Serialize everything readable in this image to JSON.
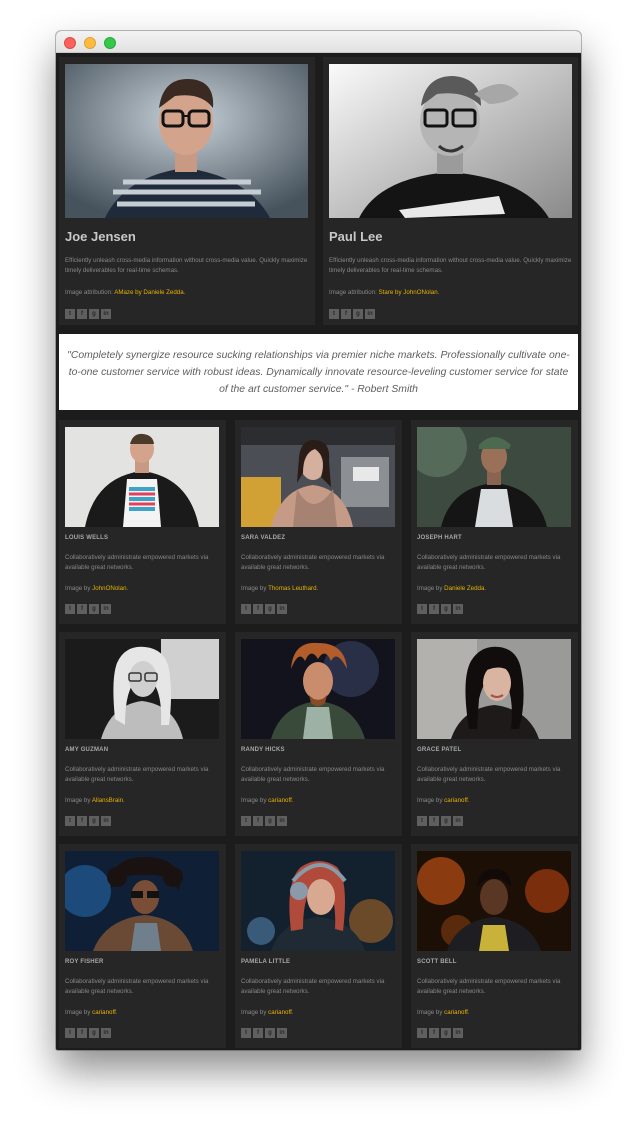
{
  "window": {
    "controls": [
      "close",
      "minimize",
      "zoom"
    ]
  },
  "featured": [
    {
      "name": "Joe Jensen",
      "description": "Efficiently unleash cross-media information without cross-media value. Quickly maximize timely deliverables for real-time schemas.",
      "attribution_prefix": "Image attribution: ",
      "attribution_link": "AMaze by Daniele Zedda",
      "attribution_suffix": "."
    },
    {
      "name": "Paul Lee",
      "description": "Efficiently unleash cross-media information without cross-media value. Quickly maximize timely deliverables for real-time schemas.",
      "attribution_prefix": "Image attribution: ",
      "attribution_link": "Stare by JohnONolan",
      "attribution_suffix": "."
    }
  ],
  "quote": {
    "text": "\"Completely synergize resource sucking relationships via premier niche markets. Professionally cultivate one-to-one customer service with robust ideas. Dynamically innovate resource-leveling customer service for state of the art customer service.\" - Robert Smith"
  },
  "members": [
    {
      "name": "Louis Wells",
      "description": "Collaboratively administrate empowered markets via available great networks.",
      "prefix": "Image by ",
      "link": "JohnONolan",
      "suffix": "."
    },
    {
      "name": "Sara Valdez",
      "description": "Collaboratively administrate empowered markets via available great networks.",
      "prefix": "Image by ",
      "link": "Thomas Leuthard",
      "suffix": "."
    },
    {
      "name": "Joseph Hart",
      "description": "Collaboratively administrate empowered markets via available great networks.",
      "prefix": "Image by ",
      "link": "Daniele Zedda",
      "suffix": "."
    },
    {
      "name": "Amy Guzman",
      "description": "Collaboratively administrate empowered markets via available great networks.",
      "prefix": "Image by ",
      "link": "AllansBrain",
      "suffix": "."
    },
    {
      "name": "Randy Hicks",
      "description": "Collaboratively administrate empowered markets via available great networks.",
      "prefix": "Image by ",
      "link": "carianoff",
      "suffix": "."
    },
    {
      "name": "Grace Patel",
      "description": "Collaboratively administrate empowered markets via available great networks.",
      "prefix": "Image by ",
      "link": "carianoff",
      "suffix": "."
    },
    {
      "name": "Roy Fisher",
      "description": "Collaboratively administrate empowered markets via available great networks.",
      "prefix": "Image by ",
      "link": "carianoff",
      "suffix": "."
    },
    {
      "name": "Pamela Little",
      "description": "Collaboratively administrate empowered markets via available great networks.",
      "prefix": "Image by ",
      "link": "carianoff",
      "suffix": "."
    },
    {
      "name": "Scott Bell",
      "description": "Collaboratively administrate empowered markets via available great networks.",
      "prefix": "Image by ",
      "link": "carianoff",
      "suffix": "."
    }
  ],
  "social_icons": [
    {
      "icon": "twitter-icon",
      "glyph": "t"
    },
    {
      "icon": "facebook-icon",
      "glyph": "f"
    },
    {
      "icon": "google-plus-icon",
      "glyph": "g"
    },
    {
      "icon": "linkedin-icon",
      "glyph": "in"
    }
  ],
  "colors": {
    "accent": "#e7b300",
    "background": "#1c1c1c",
    "card": "#262626"
  }
}
